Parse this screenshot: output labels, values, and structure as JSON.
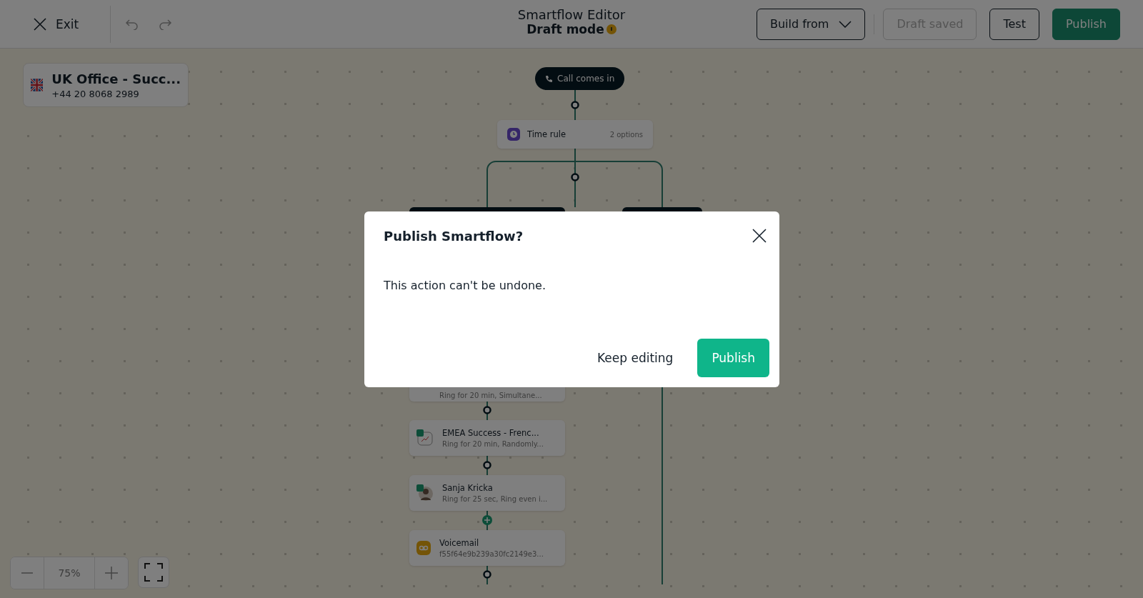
{
  "header": {
    "exit": "Exit",
    "title": "Smartflow Editor",
    "subtitle": "Draft mode",
    "build_from": "Build from",
    "draft_saved": {
      "label": "Draft saved",
      "disabled": true
    },
    "test": "Test",
    "publish": "Publish"
  },
  "number_card": {
    "name": "UK Office - Succ...",
    "phone": "+44 20 8068 2989"
  },
  "flow": {
    "start": "Call comes in",
    "time_rule": {
      "label": "Time rule",
      "options": "2 options"
    },
    "steps": [
      {
        "kind": "partial",
        "subtitle": "Ring for 20 min, Simultane..."
      },
      {
        "kind": "team",
        "title": "EMEA Success - Frenc...",
        "subtitle": "Ring for 20 min, Randomly..."
      },
      {
        "kind": "user",
        "title": "Sanja Kricka",
        "subtitle": "Ring for 25 sec, Ring even i..."
      },
      {
        "kind": "voicemail",
        "title": "Voicemail",
        "subtitle": "f55f64e9b239a30fc2149e3..."
      }
    ]
  },
  "zoom": {
    "level": "75%"
  },
  "dialog": {
    "title": "Publish Smartflow?",
    "body": "This action can't be undone.",
    "cancel": "Keep editing",
    "confirm": "Publish"
  }
}
